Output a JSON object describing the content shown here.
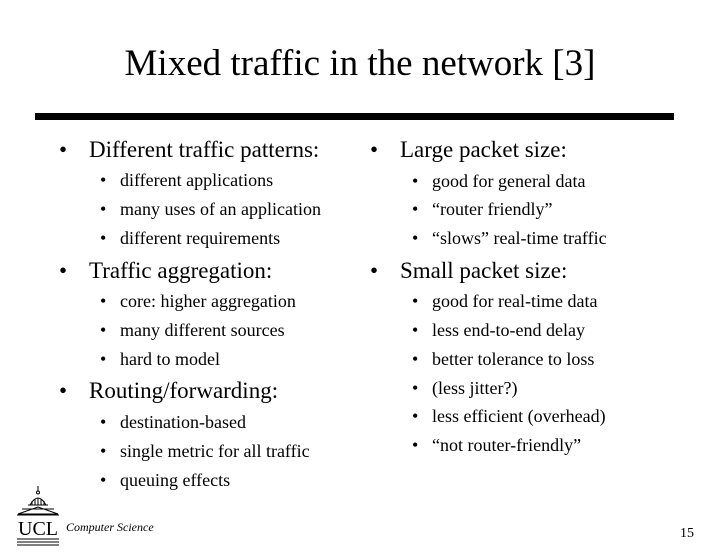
{
  "slide": {
    "title": "Mixed traffic in the network [3]",
    "page_number": "15",
    "footer_text": "Computer Science",
    "logo_text": "UCL",
    "bullet_glyph": "•"
  },
  "left_column": [
    {
      "heading": "Different traffic patterns:",
      "items": [
        "different applications",
        "many uses of an application",
        "different requirements"
      ]
    },
    {
      "heading": "Traffic aggregation:",
      "items": [
        "core: higher aggregation",
        "many different sources",
        "hard to model"
      ]
    },
    {
      "heading": "Routing/forwarding:",
      "items": [
        "destination-based",
        "single metric for all traffic",
        "queuing effects"
      ]
    }
  ],
  "right_column": [
    {
      "heading": "Large packet size:",
      "items": [
        "good for general data",
        "“router friendly”",
        "“slows” real-time traffic"
      ]
    },
    {
      "heading": "Small packet size:",
      "items": [
        "good for real-time data",
        "less end-to-end delay",
        "better tolerance to loss",
        "(less jitter?)",
        "less efficient (overhead)",
        "“not router-friendly”"
      ]
    }
  ]
}
